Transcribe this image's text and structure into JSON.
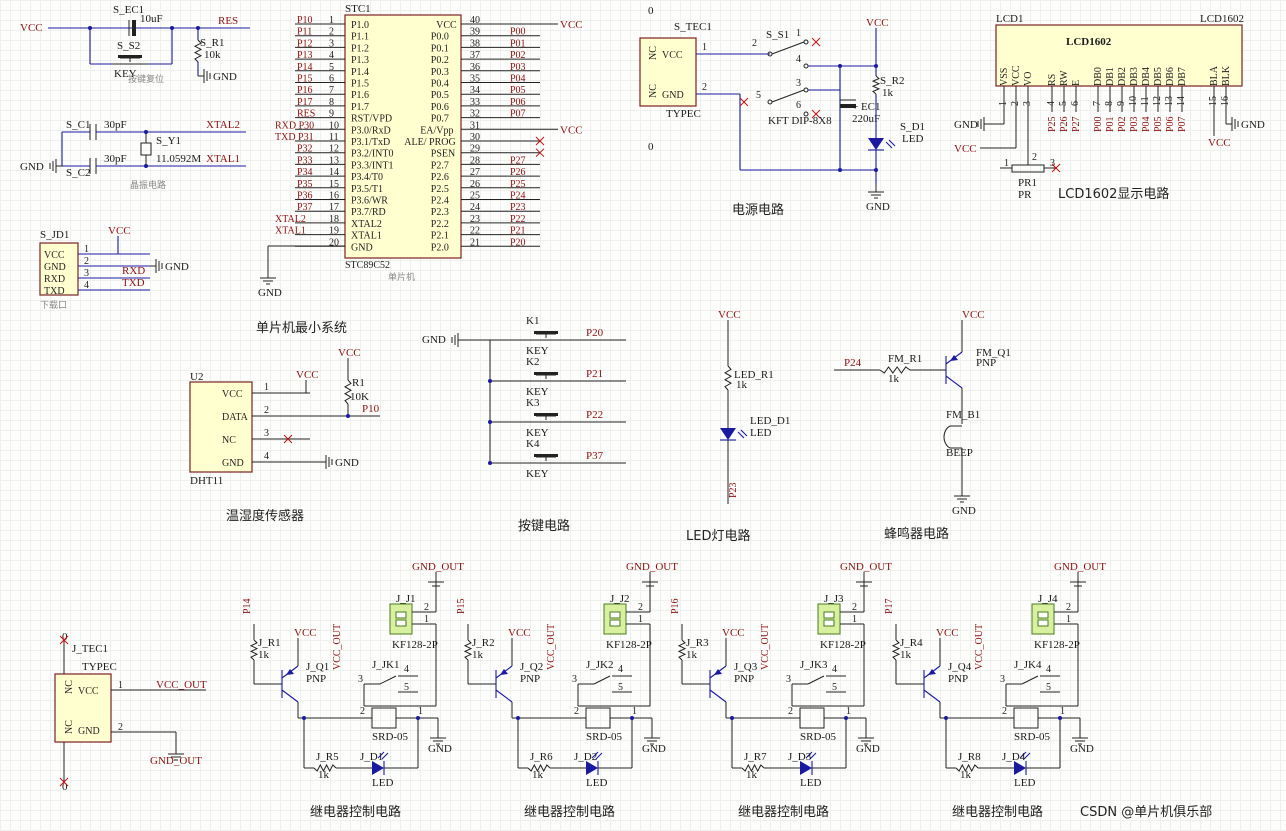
{
  "power": {
    "vcc": "VCC",
    "gnd": "GND",
    "vcc_out": "VCC_OUT",
    "gnd_out": "GND_OUT"
  },
  "reset_circuit": {
    "cap_ref": "S_EC1",
    "cap_value": "10uF",
    "res_net": "RES",
    "key_ref": "S_S2",
    "key_type": "KEY",
    "resistor_ref": "S_R1",
    "resistor_value": "10k",
    "caption": "按键复位"
  },
  "crystal_circuit": {
    "c1_ref": "S_C1",
    "c1_value": "30pF",
    "c2_ref": "S_C2",
    "c2_value": "30pF",
    "y_ref": "S_Y1",
    "y_value": "11.0592M",
    "xtal2": "XTAL2",
    "xtal1": "XTAL1",
    "caption": "晶振电路"
  },
  "download_port": {
    "ref": "S_JD1",
    "pins": [
      {
        "name": "VCC",
        "num": "1"
      },
      {
        "name": "GND",
        "num": "2"
      },
      {
        "name": "RXD",
        "num": "3"
      },
      {
        "name": "TXD",
        "num": "4"
      }
    ],
    "nets": [
      "RXD",
      "TXD"
    ],
    "caption": "下载口"
  },
  "mcu": {
    "ref": "STC1",
    "part": "STC89C52",
    "sub": "单片机",
    "caption": "单片机最小系统",
    "left_pins": [
      {
        "n": "1",
        "name": "P1.0",
        "net": "P10"
      },
      {
        "n": "2",
        "name": "P1.1",
        "net": "P11"
      },
      {
        "n": "3",
        "name": "P1.2",
        "net": "P12"
      },
      {
        "n": "4",
        "name": "P1.3",
        "net": "P13"
      },
      {
        "n": "5",
        "name": "P1.4",
        "net": "P14"
      },
      {
        "n": "6",
        "name": "P1.5",
        "net": "P15"
      },
      {
        "n": "7",
        "name": "P1.6",
        "net": "P16"
      },
      {
        "n": "8",
        "name": "P1.7",
        "net": "P17"
      },
      {
        "n": "9",
        "name": "RST/VPD",
        "net": "RES"
      },
      {
        "n": "10",
        "name": "P3.0/RxD",
        "net": "RXD P30"
      },
      {
        "n": "11",
        "name": "P3.1/TxD",
        "net": "TXD P31"
      },
      {
        "n": "12",
        "name": "P3.2/INT0",
        "net": "P32"
      },
      {
        "n": "13",
        "name": "P3.3/INT1",
        "net": "P33"
      },
      {
        "n": "14",
        "name": "P3.4/T0",
        "net": "P34"
      },
      {
        "n": "15",
        "name": "P3.5/T1",
        "net": "P35"
      },
      {
        "n": "16",
        "name": "P3.6/WR",
        "net": "P36"
      },
      {
        "n": "17",
        "name": "P3.7/RD",
        "net": "P37"
      },
      {
        "n": "18",
        "name": "XTAL2",
        "net": "XTAL2"
      },
      {
        "n": "19",
        "name": "XTAL1",
        "net": "XTAL1"
      },
      {
        "n": "20",
        "name": "GND",
        "net": ""
      }
    ],
    "right_pins": [
      {
        "n": "40",
        "name": "VCC",
        "net": "VCC"
      },
      {
        "n": "39",
        "name": "P0.0",
        "net": "P00"
      },
      {
        "n": "38",
        "name": "P0.1",
        "net": "P01"
      },
      {
        "n": "37",
        "name": "P0.2",
        "net": "P02"
      },
      {
        "n": "36",
        "name": "P0.3",
        "net": "P03"
      },
      {
        "n": "35",
        "name": "P0.4",
        "net": "P04"
      },
      {
        "n": "34",
        "name": "P0.5",
        "net": "P05"
      },
      {
        "n": "33",
        "name": "P0.6",
        "net": "P06"
      },
      {
        "n": "32",
        "name": "P0.7",
        "net": "P07"
      },
      {
        "n": "31",
        "name": "EA/Vpp",
        "net": "VCC"
      },
      {
        "n": "30",
        "name": "ALE/ PROG",
        "net": ""
      },
      {
        "n": "29",
        "name": "PSEN",
        "net": ""
      },
      {
        "n": "28",
        "name": "P2.7",
        "net": "P27"
      },
      {
        "n": "27",
        "name": "P2.6",
        "net": "P26"
      },
      {
        "n": "26",
        "name": "P2.5",
        "net": "P25"
      },
      {
        "n": "25",
        "name": "P2.4",
        "net": "P24"
      },
      {
        "n": "24",
        "name": "P2.3",
        "net": "P23"
      },
      {
        "n": "23",
        "name": "P2.2",
        "net": "P22"
      },
      {
        "n": "22",
        "name": "P2.1",
        "net": "P21"
      },
      {
        "n": "21",
        "name": "P2.0",
        "net": "P20"
      }
    ]
  },
  "power_circuit": {
    "tec_ref": "S_TEC1",
    "tec_part": "TYPEC",
    "tec_pins": [
      "NC",
      "VCC",
      "NC",
      "GND"
    ],
    "tec_nums": [
      "1",
      "2"
    ],
    "switch_ref": "S_S1",
    "switch_part": "KFT DIP-8X8",
    "switch_pins": [
      "1",
      "2",
      "3",
      "4",
      "5",
      "6"
    ],
    "cap_ref": "EC1",
    "cap_value": "220uF",
    "res_ref": "S_R2",
    "res_value": "1k",
    "led_ref": "S_D1",
    "led_type": "LED",
    "zeros": [
      "0",
      "0"
    ],
    "caption": "电源电路"
  },
  "lcd": {
    "ref": "LCD1",
    "part": "LCD1602",
    "title": "LCD1602",
    "pins": [
      "VSS",
      "VCC",
      "VO",
      "RS",
      "RW",
      "E",
      "DB0",
      "DB1",
      "DB2",
      "DB3",
      "DB4",
      "DB5",
      "DB6",
      "DB7",
      "BLA",
      "BLK"
    ],
    "nums": [
      "1",
      "2",
      "3",
      "4",
      "5",
      "6",
      "7",
      "8",
      "9",
      "10",
      "11",
      "12",
      "13",
      "14",
      "15",
      "16"
    ],
    "nets": [
      "P25",
      "P26",
      "P27",
      "P00",
      "P01",
      "P02",
      "P03",
      "P04",
      "P05",
      "P06",
      "P07"
    ],
    "pot_ref": "PR1",
    "pot_part": "PR",
    "pot_pins": [
      "1",
      "2",
      "3"
    ],
    "caption": "LCD1602显示电路"
  },
  "dht11": {
    "ref": "U2",
    "part": "DHT11",
    "pins": [
      {
        "name": "VCC",
        "n": "1"
      },
      {
        "name": "DATA",
        "n": "2"
      },
      {
        "name": "NC",
        "n": "3"
      },
      {
        "name": "GND",
        "n": "4"
      }
    ],
    "r_ref": "R1",
    "r_value": "10K",
    "net": "P10",
    "caption": "温湿度传感器"
  },
  "keys": {
    "items": [
      {
        "ref": "K1",
        "net": "P20"
      },
      {
        "ref": "K2",
        "net": "P21"
      },
      {
        "ref": "K3",
        "net": "P22"
      },
      {
        "ref": "K4",
        "net": "P37"
      }
    ],
    "type": "KEY",
    "caption": "按键电路"
  },
  "led_circuit": {
    "r_ref": "LED_R1",
    "r_value": "1k",
    "d_ref": "LED_D1",
    "d_type": "LED",
    "net": "P23",
    "caption": "LED灯电路"
  },
  "buzzer": {
    "r_ref": "FM_R1",
    "r_value": "1k",
    "q_ref": "FM_Q1",
    "q_type": "PNP",
    "b_ref": "FM_B1",
    "b_type": "BEEP",
    "net": "P24",
    "caption": "蜂鸣器电路"
  },
  "tec2": {
    "ref": "J_TEC1",
    "part": "TYPEC",
    "pins": [
      "NC",
      "VCC",
      "NC",
      "GND"
    ],
    "nums": [
      "1",
      "2"
    ],
    "zeros": [
      "0",
      "0"
    ]
  },
  "relays": [
    {
      "net": "P14",
      "r": "J_R1",
      "q": "J_Q1",
      "j": "J_J1",
      "jk": "J_JK1",
      "r2": "J_R5",
      "d": "J_D1"
    },
    {
      "net": "P15",
      "r": "J_R2",
      "q": "J_Q2",
      "j": "J_J2",
      "jk": "J_JK2",
      "r2": "J_R6",
      "d": "J_D2"
    },
    {
      "net": "P16",
      "r": "J_R3",
      "q": "J_Q3",
      "j": "J_J3",
      "jk": "J_JK3",
      "r2": "J_R7",
      "d": "J_D3"
    },
    {
      "net": "P17",
      "r": "J_R4",
      "q": "J_Q4",
      "j": "J_J4",
      "jk": "J_JK4",
      "r2": "J_R8",
      "d": "J_D4"
    }
  ],
  "relay_common": {
    "r_value": "1k",
    "q_type": "PNP",
    "j_part": "KF128-2P",
    "relay_part": "SRD-05",
    "led": "LED",
    "pins": [
      "1",
      "2",
      "3",
      "4",
      "5"
    ],
    "caption": "继电器控制电路"
  },
  "watermark": "CSDN @单片机俱乐部"
}
